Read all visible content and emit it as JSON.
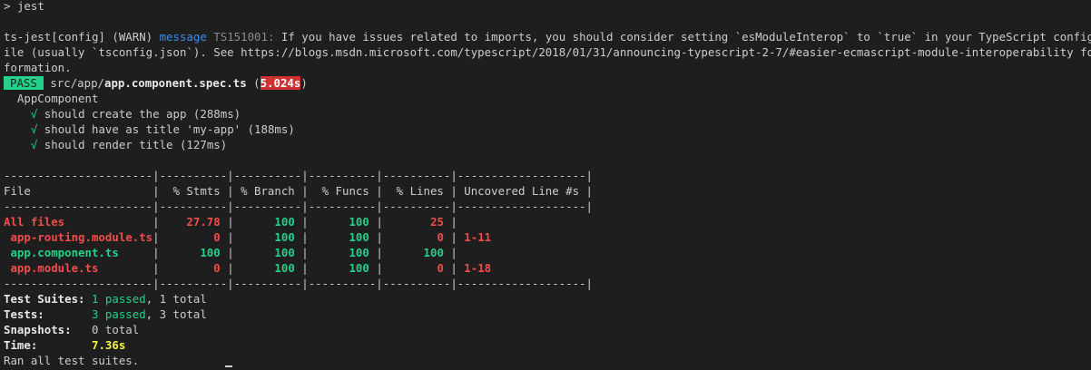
{
  "prompt": {
    "symbol": ">",
    "command": "jest"
  },
  "warning": {
    "prefix": "ts-jest[config] (WARN)",
    "label": "message",
    "code": "TS151001:",
    "line1": "If you have issues related to imports, you should consider setting `esModuleInterop` to `true` in your TypeScript configuration f",
    "line2": "ile (usually `tsconfig.json`). See https://blogs.msdn.microsoft.com/typescript/2018/01/31/announcing-typescript-2-7/#easier-ecmascript-module-interoperability for more in",
    "line3": "formation."
  },
  "result": {
    "badge": "PASS",
    "path_dir": "src/app/",
    "path_file": "app.component.spec.ts",
    "duration": "5.024s"
  },
  "suite": {
    "name": "AppComponent",
    "tests": [
      {
        "check": "√",
        "label": "should create the app (288ms)"
      },
      {
        "check": "√",
        "label": "should have as title 'my-app' (188ms)"
      },
      {
        "check": "√",
        "label": "should render title (127ms)"
      }
    ]
  },
  "coverage": {
    "separator": "----------------------|----------|----------|----------|----------|-------------------|",
    "header": "File                  |  % Stmts | % Branch |  % Funcs |  % Lines | Uncovered Line #s |",
    "rows": [
      {
        "file": "All files",
        "stmts": "27.78",
        "branch": "100",
        "funcs": "100",
        "lines": "25",
        "uncovered": "",
        "color": "#f14c4c",
        "bold": true,
        "indent": false
      },
      {
        "file": "app-routing.module.ts",
        "stmts": "0",
        "branch": "100",
        "funcs": "100",
        "lines": "0",
        "uncovered": "1-11",
        "color": "#f14c4c",
        "bold": true,
        "indent": true
      },
      {
        "file": "app.component.ts",
        "stmts": "100",
        "branch": "100",
        "funcs": "100",
        "lines": "100",
        "uncovered": "",
        "color": "#23d18b",
        "bold": true,
        "indent": true
      },
      {
        "file": "app.module.ts",
        "stmts": "0",
        "branch": "100",
        "funcs": "100",
        "lines": "0",
        "uncovered": "1-18",
        "color": "#f14c4c",
        "bold": true,
        "indent": true
      }
    ],
    "metric_colors": {
      "stmts": [
        "#f14c4c",
        "#f14c4c",
        "#23d18b",
        "#f14c4c"
      ],
      "lines": [
        "#f14c4c",
        "#f14c4c",
        "#23d18b",
        "#f14c4c"
      ]
    }
  },
  "summary": {
    "suites_label": "Test Suites:",
    "suites_passed": "1 passed",
    "suites_total": ", 1 total",
    "tests_label": "Tests:",
    "tests_passed": "3 passed",
    "tests_total": ", 3 total",
    "snapshots_label": "Snapshots:",
    "snapshots_value": "0 total",
    "time_label": "Time:",
    "time_value": "7.36s",
    "ran": "Ran all test suites."
  }
}
